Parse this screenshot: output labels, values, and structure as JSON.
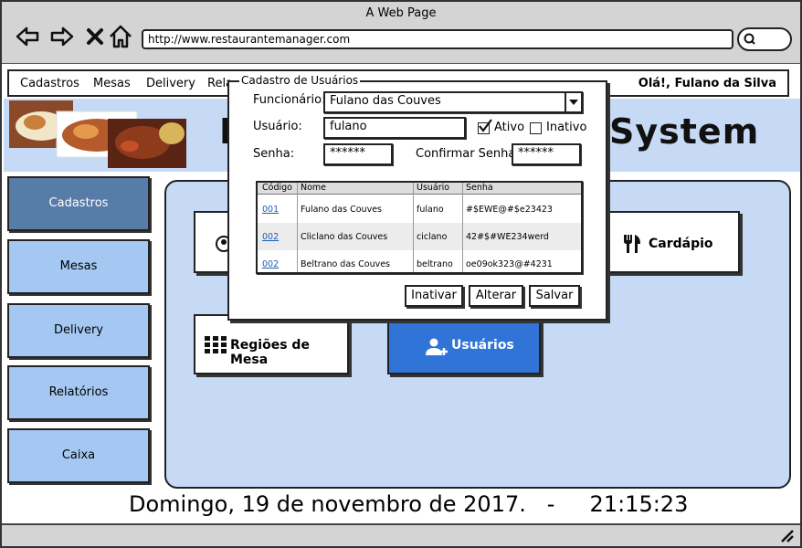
{
  "window": {
    "title": "A Web Page"
  },
  "browser": {
    "url": "http://www.restaurantemanager.com",
    "icons": [
      "back-arrow-icon",
      "forward-arrow-icon",
      "close-icon",
      "home-icon",
      "search-icon"
    ]
  },
  "menu": {
    "items": [
      "Cadastros",
      "Mesas",
      "Delivery",
      "Rela"
    ],
    "greeting": "Olá!, Fulano da Silva"
  },
  "banner": {
    "title_visible_left": "M",
    "title_visible_right": "System"
  },
  "sidebar": {
    "items": [
      {
        "label": "Cadastros",
        "active": true
      },
      {
        "label": "Mesas",
        "active": false
      },
      {
        "label": "Delivery",
        "active": false
      },
      {
        "label": "Relatórios",
        "active": false
      },
      {
        "label": "Caixa",
        "active": false
      }
    ]
  },
  "tiles": {
    "cardapio": {
      "label": "Cardápio",
      "icon": "fork-knife-icon"
    },
    "regioes": {
      "label": "Regiões de Mesa",
      "icon": "grid-icon"
    },
    "usuarios": {
      "label": "Usuários",
      "icon": "add-user-icon"
    }
  },
  "footer": {
    "datetime": "Domingo, 19 de novembro de 2017.   -     21:15:23"
  },
  "dialog": {
    "title": "Cadastro de Usuários",
    "funcionario_label": "Funcionário:",
    "funcionario_value": "Fulano das Couves",
    "usuario_label": "Usuário:",
    "usuario_value": "fulano",
    "ativo_label": "Ativo",
    "ativo_checked": true,
    "inativo_label": "Inativo",
    "inativo_checked": false,
    "senha_label": "Senha:",
    "senha_value": "******",
    "confirmar_label": "Confirmar Senha:",
    "confirmar_value": "******",
    "table": {
      "headers": [
        "Código",
        "Nome",
        "Usuário",
        "Senha"
      ],
      "rows": [
        [
          "001",
          "Fulano das Couves",
          "fulano",
          "#$EWE@#$e23423"
        ],
        [
          "002",
          "Cliclano das Couves",
          "ciclano",
          "42#$#WE234werd"
        ],
        [
          "002",
          "Beltrano das Couves",
          "beltrano",
          "oe09ok323@#4231"
        ]
      ]
    },
    "buttons": {
      "inativar": "Inativar",
      "alterar": "Alterar",
      "salvar": "Salvar"
    }
  },
  "colors": {
    "chrome": "#d4d4d4",
    "banner_bg": "#c7daf5",
    "sidebar_btn": "#a4c8f2",
    "sidebar_active": "#587ca8",
    "accent_blue": "#2f74d6"
  }
}
